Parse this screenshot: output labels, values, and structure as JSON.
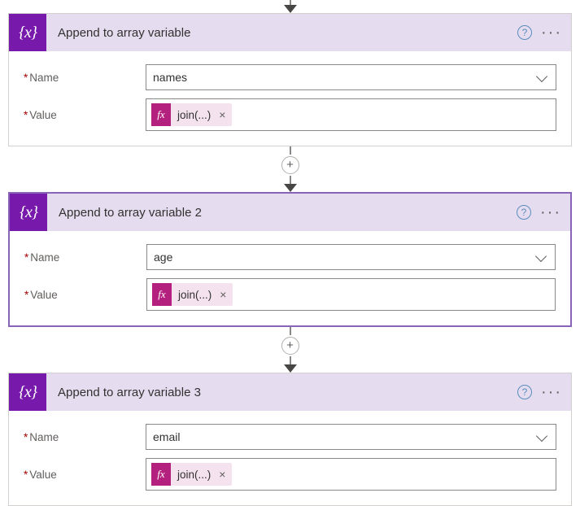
{
  "labels": {
    "name": "Name",
    "value": "Value",
    "tokenFx": "fx",
    "tokenClose": "×",
    "help": "?",
    "more": "···",
    "plus": "+",
    "iconText": "{x}"
  },
  "actions": [
    {
      "title": "Append to array variable",
      "nameField": "names",
      "valueToken": "join(...)",
      "selected": false,
      "hasTopPlus": false
    },
    {
      "title": "Append to array variable 2",
      "nameField": "age",
      "valueToken": "join(...)",
      "selected": true,
      "hasTopPlus": true
    },
    {
      "title": "Append to array variable 3",
      "nameField": "email",
      "valueToken": "join(...)",
      "selected": false,
      "hasTopPlus": true
    }
  ]
}
